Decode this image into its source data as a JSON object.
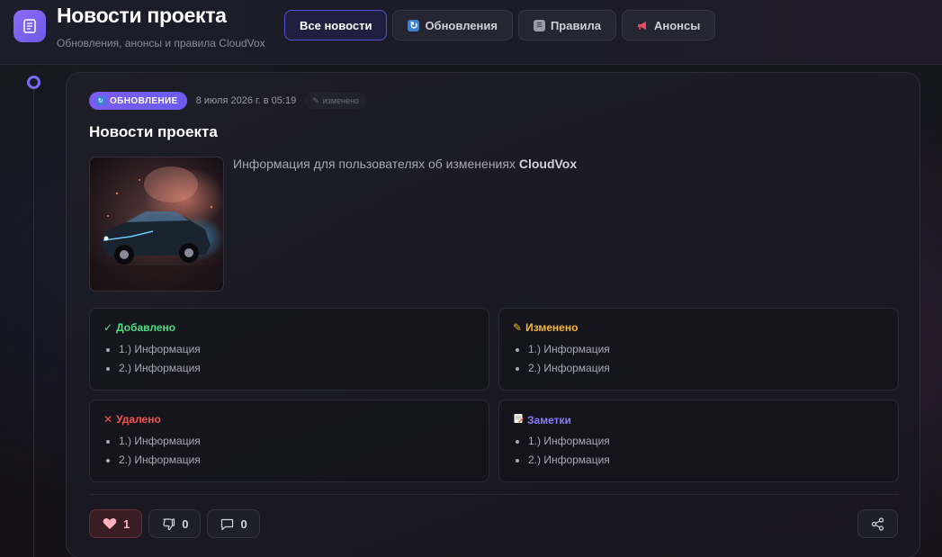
{
  "header": {
    "title": "Новости проекта",
    "subtitle": "Обновления, анонсы и правила CloudVox",
    "app_icon": "document-icon"
  },
  "tabs": [
    {
      "label": "Все новости",
      "icon": "",
      "active": true
    },
    {
      "label": "Обновления",
      "icon": "refresh-icon",
      "active": false
    },
    {
      "label": "Правила",
      "icon": "clipboard-icon",
      "active": false
    },
    {
      "label": "Анонсы",
      "icon": "megaphone-icon",
      "active": false
    }
  ],
  "post": {
    "badge": "ОБНОВЛЕНИЕ",
    "date": "8 июля 2026 г. в 05:19",
    "edited": "изменено",
    "title": "Новости проекта",
    "description_prefix": "Информация для пользователях об изменениях ",
    "description_brand": "CloudVox",
    "image_alt": "car-image",
    "sections": [
      {
        "title": "Добавлено",
        "icon": "check-icon",
        "color": "#4ade80",
        "items": [
          "1.) Информация",
          "2.) Информация"
        ]
      },
      {
        "title": "Изменено",
        "icon": "pencil-icon",
        "color": "#f5b72a",
        "items": [
          "1.) Информация",
          "2.) Информация"
        ]
      },
      {
        "title": "Удалено",
        "icon": "cross-icon",
        "color": "#f05252",
        "items": [
          "1.) Информация",
          "2.) Информация"
        ]
      },
      {
        "title": "Заметки",
        "icon": "memo-icon",
        "color": "#8b7cf6",
        "items": [
          "1.) Информация",
          "2.) Информация"
        ]
      }
    ],
    "actions": {
      "likes": "1",
      "dislikes": "0",
      "comments": "0"
    }
  },
  "colors": {
    "accent": "#7c5cf2",
    "like": "#ffb3bf"
  }
}
